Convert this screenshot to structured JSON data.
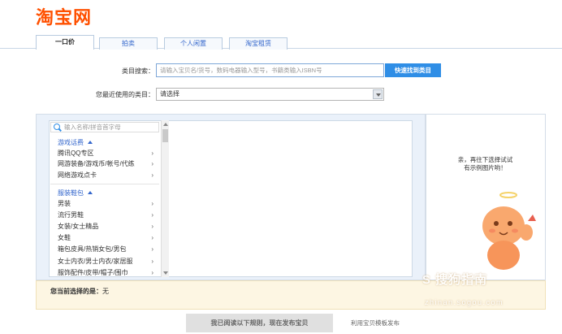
{
  "header": {
    "logo": "淘宝网"
  },
  "tabs": [
    {
      "label": "一口价",
      "active": true
    },
    {
      "label": "拍卖",
      "active": false
    },
    {
      "label": "个人闲置",
      "active": false
    },
    {
      "label": "淘宝租赁",
      "active": false
    }
  ],
  "search": {
    "label": "类目搜索：",
    "placeholder": "请输入宝贝名/货号，数码电器输入型号，书籍类输入ISBN号",
    "button": "快速找到类目"
  },
  "recent": {
    "label": "您最近使用的类目：",
    "value": "请选择"
  },
  "category_list": {
    "filter_placeholder": "输入名称/拼音首字母",
    "groups": [
      {
        "title": "游戏话费",
        "items": [
          "腾讯QQ专区",
          "网游装备/游戏币/帐号/代练",
          "网络游戏点卡"
        ]
      },
      {
        "title": "服装鞋包",
        "items": [
          "男装",
          "流行男鞋",
          "女装/女士精品",
          "女鞋",
          "箱包皮具/热销女包/男包",
          "女士内衣/男士内衣/家居服",
          "服饰配件/皮带/帽子/围巾"
        ]
      }
    ],
    "chevron": "›"
  },
  "hint": {
    "line1": "亲，再往下选择试试",
    "line2": "有示例图片哟！"
  },
  "selected": {
    "label": "您当前选择的是：",
    "value": "无"
  },
  "watermark": {
    "text": "S 搜狗指南",
    "url": "zhinan.sogou.com"
  },
  "footer": {
    "publish_button": "我已阅读以下规则，现在发布宝贝",
    "template_link": "利用宝贝模板发布"
  },
  "colors": {
    "brand": "#ff5000",
    "link": "#3366cc",
    "button": "#2f8ee6"
  }
}
